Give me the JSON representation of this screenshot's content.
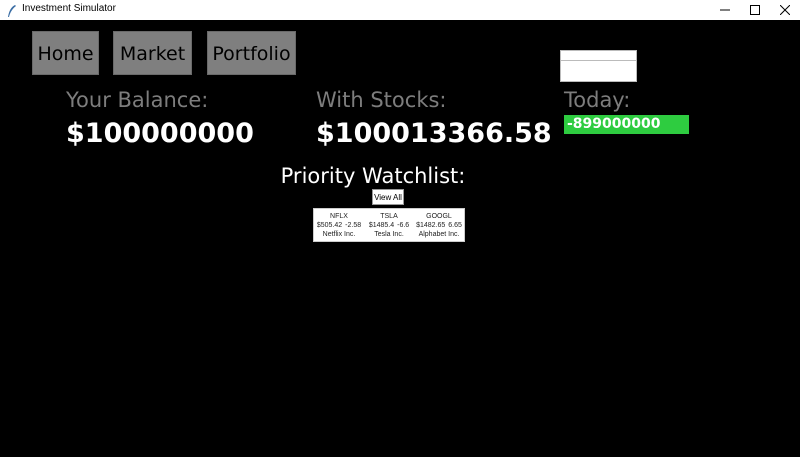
{
  "window": {
    "title": "Investment Simulator",
    "icon": "feather-icon"
  },
  "nav": {
    "home": "Home",
    "market": "Market",
    "portfolio": "Portfolio"
  },
  "balance": {
    "label": "Your Balance:",
    "value": "$100000000"
  },
  "with_stocks": {
    "label": "With Stocks:",
    "value": "$100013366.58"
  },
  "today": {
    "label": "Today:",
    "value": "-899000000",
    "color": "#2ecc40"
  },
  "watchlist": {
    "title": "Priority Watchlist:",
    "view_all": "View All",
    "stocks": [
      {
        "symbol": "NFLX",
        "price": "$505.42",
        "change": "-2.58",
        "name": "Netflix Inc."
      },
      {
        "symbol": "TSLA",
        "price": "$1485.4",
        "change": "-6.6",
        "name": "Tesla Inc."
      },
      {
        "symbol": "GOOGL",
        "price": "$1482.65",
        "change": "6.65",
        "name": "Alphabet Inc."
      }
    ]
  }
}
